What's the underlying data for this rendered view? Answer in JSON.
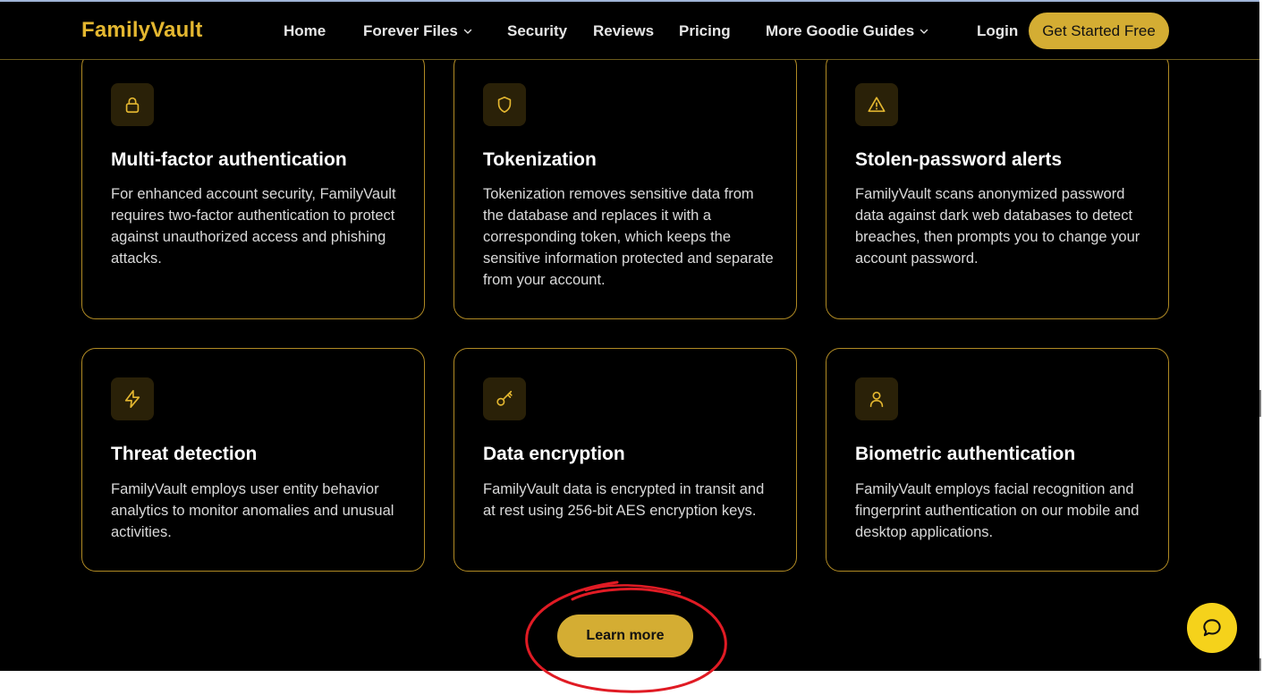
{
  "brand": {
    "logo": "FamilyVault",
    "accent": "#d4ad33"
  },
  "nav": {
    "home": "Home",
    "forever_files": "Forever Files",
    "security": "Security",
    "reviews": "Reviews",
    "pricing": "Pricing",
    "more_guides": "More Goodie Guides",
    "login": "Login",
    "cta": "Get Started Free"
  },
  "features": [
    {
      "icon": "lock-icon",
      "title": "Multi-factor authentication",
      "body": "For enhanced account security, FamilyVault requires two-factor authentication to protect against unauthorized access and phishing attacks."
    },
    {
      "icon": "shield-icon",
      "title": "Tokenization",
      "body": "Tokenization removes sensitive data from the database and replaces it with a corresponding token, which keeps the sensitive information protected and separate from your account."
    },
    {
      "icon": "warning-icon",
      "title": "Stolen-password alerts",
      "body": "FamilyVault scans anonymized password data against dark web databases to detect breaches, then prompts you to change your account password."
    },
    {
      "icon": "lightning-icon",
      "title": "Threat detection",
      "body": "FamilyVault employs user entity behavior analytics to monitor anomalies and unusual activities."
    },
    {
      "icon": "key-icon",
      "title": "Data encryption",
      "body": "FamilyVault data is encrypted in transit and at rest using 256-bit AES encryption keys."
    },
    {
      "icon": "user-icon",
      "title": "Biometric authentication",
      "body": "FamilyVault employs facial recognition and fingerprint authentication on our mobile and desktop applications."
    }
  ],
  "learn_more": "Learn more",
  "chat": {
    "icon": "chat-bubble-icon"
  },
  "annotation": {
    "shape": "red-hand-drawn-circle",
    "color": "#e01b24"
  }
}
